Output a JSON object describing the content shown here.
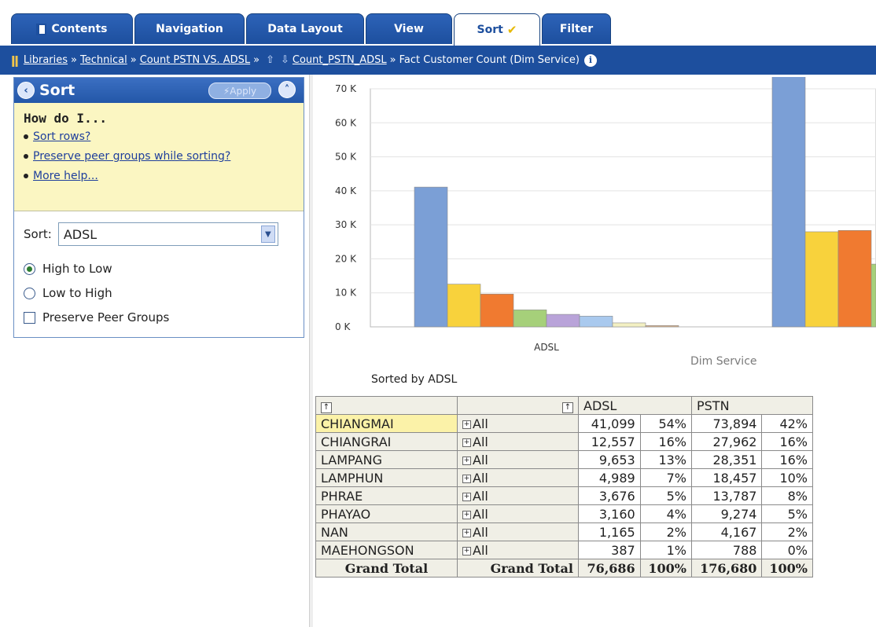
{
  "tabs": [
    {
      "label": "Contents",
      "icon": "document-icon"
    },
    {
      "label": "Navigation"
    },
    {
      "label": "Data Layout"
    },
    {
      "label": "View"
    },
    {
      "label": "Sort",
      "active": true,
      "icon": "checkmark-icon",
      "check": "✔"
    },
    {
      "label": "Filter"
    }
  ],
  "breadcrumb": {
    "items": [
      "Libraries",
      "Technical",
      "Count PSTN VS. ADSL",
      "Count_PSTN_ADSL"
    ],
    "current": "Fact Customer Count (Dim Service)",
    "info": "i"
  },
  "sort_panel": {
    "title": "Sort",
    "apply_label": "Apply",
    "howdo": {
      "heading": "How do I...",
      "links": [
        "Sort rows?",
        "Preserve peer groups while sorting?",
        "More help..."
      ]
    },
    "sort_label": "Sort:",
    "sort_value": "ADSL",
    "options": {
      "high_to_low": "High to Low",
      "low_to_high": "Low to High",
      "selected": "high_to_low"
    },
    "preserve_label": "Preserve Peer Groups"
  },
  "chart_data": {
    "type": "bar",
    "categories": [
      "ADSL",
      "PSTN"
    ],
    "series": [
      {
        "values": [
          41099,
          73894
        ],
        "color": "#7b9fd6"
      },
      {
        "values": [
          12557,
          27962
        ],
        "color": "#f8d23c"
      },
      {
        "values": [
          9653,
          28351
        ],
        "color": "#f07a30"
      },
      {
        "values": [
          4989,
          18457
        ],
        "color": "#a6d07a"
      },
      {
        "values": [
          3676,
          13787
        ],
        "color": "#b9a3d9"
      },
      {
        "values": [
          3160,
          9274
        ],
        "color": "#a9c9ee"
      },
      {
        "values": [
          1165,
          4167
        ],
        "color": "#f3f0c2"
      },
      {
        "values": [
          387,
          788
        ],
        "color": "#d9b38c"
      }
    ],
    "ylim": [
      0,
      70000
    ],
    "yticks": [
      "0 K",
      "10 K",
      "20 K",
      "30 K",
      "40 K",
      "50 K",
      "60 K",
      "70 K"
    ],
    "xlabel": "Dim Service",
    "grid": true
  },
  "sorted_by": "Sorted by ADSL",
  "table": {
    "columns": [
      "ADSL",
      "PSTN"
    ],
    "rows": [
      {
        "province": "CHIANGMAI",
        "member": "All",
        "adsl": "41,099",
        "adsl_pct": "54%",
        "pstn": "73,894",
        "pstn_pct": "42%"
      },
      {
        "province": "CHIANGRAI",
        "member": "All",
        "adsl": "12,557",
        "adsl_pct": "16%",
        "pstn": "27,962",
        "pstn_pct": "16%"
      },
      {
        "province": "LAMPANG",
        "member": "All",
        "adsl": "9,653",
        "adsl_pct": "13%",
        "pstn": "28,351",
        "pstn_pct": "16%"
      },
      {
        "province": "LAMPHUN",
        "member": "All",
        "adsl": "4,989",
        "adsl_pct": "7%",
        "pstn": "18,457",
        "pstn_pct": "10%"
      },
      {
        "province": "PHRAE",
        "member": "All",
        "adsl": "3,676",
        "adsl_pct": "5%",
        "pstn": "13,787",
        "pstn_pct": "8%"
      },
      {
        "province": "PHAYAO",
        "member": "All",
        "adsl": "3,160",
        "adsl_pct": "4%",
        "pstn": "9,274",
        "pstn_pct": "5%"
      },
      {
        "province": "NAN",
        "member": "All",
        "adsl": "1,165",
        "adsl_pct": "2%",
        "pstn": "4,167",
        "pstn_pct": "2%"
      },
      {
        "province": "MAEHONGSON",
        "member": "All",
        "adsl": "387",
        "adsl_pct": "1%",
        "pstn": "788",
        "pstn_pct": "0%"
      }
    ],
    "grand_total": {
      "label1": "Grand Total",
      "label2": "Grand Total",
      "adsl": "76,686",
      "adsl_pct": "100%",
      "pstn": "176,680",
      "pstn_pct": "100%"
    }
  }
}
